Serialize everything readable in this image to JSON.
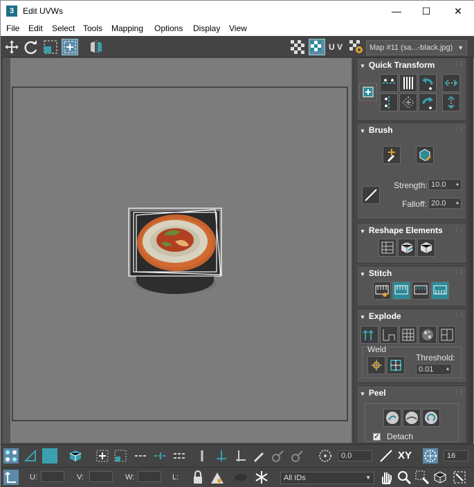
{
  "window": {
    "title": "Edit UVWs",
    "app_icon_text": "3",
    "minimize": "—",
    "maximize": "☐",
    "close": "✕"
  },
  "menu": [
    "File",
    "Edit",
    "Select",
    "Tools",
    "Mapping",
    "Options",
    "Display",
    "View"
  ],
  "toolbar": {
    "uv_label": "U V",
    "map_select": "Map #11 (sa...-black.jpg)"
  },
  "rollouts": {
    "quick_transform": {
      "title": "Quick Transform"
    },
    "brush": {
      "title": "Brush",
      "strength_label": "Strength:",
      "strength_value": "10.0",
      "falloff_label": "Falloff:",
      "falloff_value": "20.0"
    },
    "reshape": {
      "title": "Reshape Elements"
    },
    "stitch": {
      "title": "Stitch"
    },
    "explode": {
      "title": "Explode",
      "weld_label": "Weld",
      "threshold_label": "Threshold:",
      "threshold_value": "0.01"
    },
    "peel": {
      "title": "Peel",
      "detach_label": "Detach",
      "detach_checked": true
    }
  },
  "bottom": {
    "rotate_value": "0.0",
    "xy_label": "XY",
    "grid_value": "16",
    "u_label": "U:",
    "v_label": "V:",
    "w_label": "W:",
    "l_label": "L:",
    "ids_select": "All IDs"
  },
  "colors": {
    "accent_teal": "#2a8a96",
    "viewport_bg": "#7c7c7c",
    "panel_bg": "#555555"
  }
}
